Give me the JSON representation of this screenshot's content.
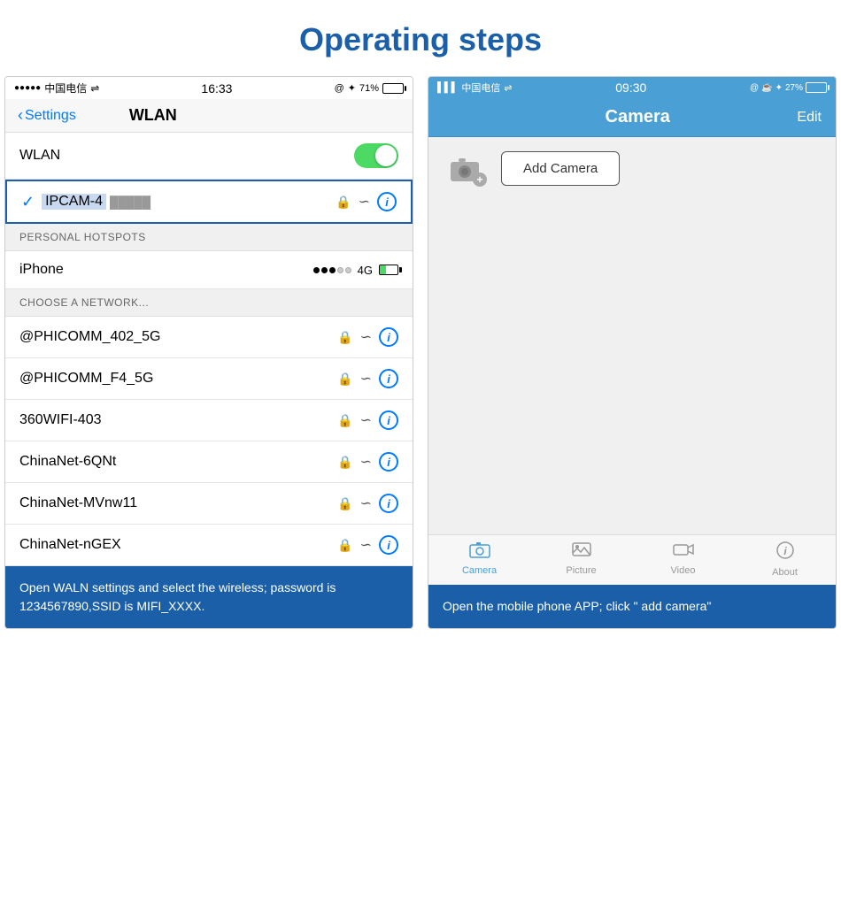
{
  "page": {
    "title": "Operating steps"
  },
  "left_phone": {
    "status_bar": {
      "signal": "●●●●● 中国电信 ✦",
      "time": "16:33",
      "right": "@ ✦ 71%"
    },
    "nav": {
      "back": "Settings",
      "title": "WLAN"
    },
    "wlan_label": "WLAN",
    "connected_network": "IPCAM-4",
    "sections": {
      "personal_hotspots": "PERSONAL HOTSPOTS",
      "choose_network": "CHOOSE A NETWORK..."
    },
    "personal_network": "iPhone",
    "networks": [
      "@PHICOMM_402_5G",
      "@PHICOMM_F4_5G",
      "360WIFI-403",
      "ChinaNet-6QNt",
      "ChinaNet-MVnw11",
      "ChinaNet-nGEX"
    ],
    "caption": "Open WALN settings and select the wireless; password is 1234567890,SSID is MIFI_XXXX."
  },
  "right_phone": {
    "status_bar": {
      "left": "▌▌▌ 中国电信 ✦",
      "time": "09:30",
      "right": "@ ✦ ✦ 27%"
    },
    "nav": {
      "title": "Camera",
      "edit": "Edit"
    },
    "add_camera_button": "Add Camera",
    "tabs": [
      {
        "icon": "📹",
        "label": "Camera",
        "active": true
      },
      {
        "icon": "🖼",
        "label": "Picture",
        "active": false
      },
      {
        "icon": "🎬",
        "label": "Video",
        "active": false
      },
      {
        "icon": "ℹ",
        "label": "About",
        "active": false
      }
    ],
    "caption": "Open the mobile phone APP; click \" add camera\""
  }
}
